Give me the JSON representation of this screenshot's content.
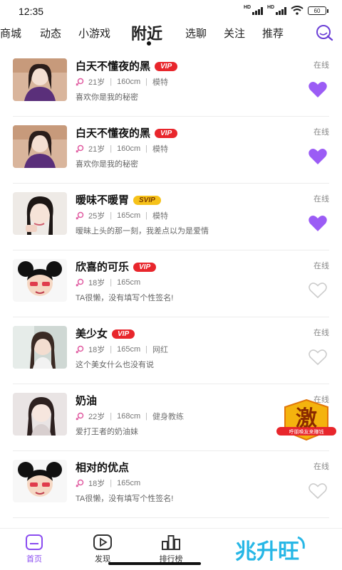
{
  "status_bar": {
    "time": "12:35",
    "battery": "60",
    "signal_label": "HD"
  },
  "tabs": [
    {
      "label": "商城",
      "active": false
    },
    {
      "label": "动态",
      "active": false
    },
    {
      "label": "小游戏",
      "active": false
    },
    {
      "label": "附近",
      "active": true
    },
    {
      "label": "选聊",
      "active": false
    },
    {
      "label": "关注",
      "active": false
    },
    {
      "label": "推荐",
      "active": false
    }
  ],
  "users": [
    {
      "name": "白天不懂夜的黑",
      "badge": "VIP",
      "age": "21岁",
      "height": "160cm",
      "job": "模特",
      "signature": "喜欢你是我的秘密",
      "status": "在线",
      "liked": true
    },
    {
      "name": "白天不懂夜的黑",
      "badge": "VIP",
      "age": "21岁",
      "height": "160cm",
      "job": "模特",
      "signature": "喜欢你是我的秘密",
      "status": "在线",
      "liked": true
    },
    {
      "name": "暖味不暖胃",
      "badge": "SVIP",
      "age": "25岁",
      "height": "165cm",
      "job": "模特",
      "signature": "暧昧上头的那一刻，我差点以为是爱情",
      "status": "在线",
      "liked": true
    },
    {
      "name": "欣喜的可乐",
      "badge": "VIP",
      "age": "18岁",
      "height": "165cm",
      "job": "",
      "signature": "TA很懒，没有填写个性签名!",
      "status": "在线",
      "liked": false
    },
    {
      "name": "美少女",
      "badge": "VIP",
      "age": "18岁",
      "height": "165cm",
      "job": "网红",
      "signature": "这个美女什么也没有说",
      "status": "在线",
      "liked": false
    },
    {
      "name": "奶油",
      "badge": "",
      "age": "22岁",
      "height": "168cm",
      "job": "健身教练",
      "signature": "爱打王者的奶油妹",
      "status": "在线",
      "liked": false
    },
    {
      "name": "相对的优点",
      "badge": "",
      "age": "18岁",
      "height": "165cm",
      "job": "",
      "signature": "TA很懒，没有填写个性签名!",
      "status": "在线",
      "liked": false
    }
  ],
  "promo": {
    "char": "激",
    "caption": "呼朋唤友来赚钱"
  },
  "bottom_nav": [
    {
      "label": "首页",
      "icon": "home-icon",
      "active": true
    },
    {
      "label": "发现",
      "icon": "play-icon",
      "active": false
    },
    {
      "label": "排行榜",
      "icon": "ranking-icon",
      "active": false
    }
  ],
  "brand": {
    "text": "兆升旺"
  },
  "colors": {
    "accent": "#8a4cf0",
    "vip": "#e8262c",
    "svip": "#f6c21a",
    "heart_active": "#9b5cf5",
    "female": "#e05aa0"
  }
}
